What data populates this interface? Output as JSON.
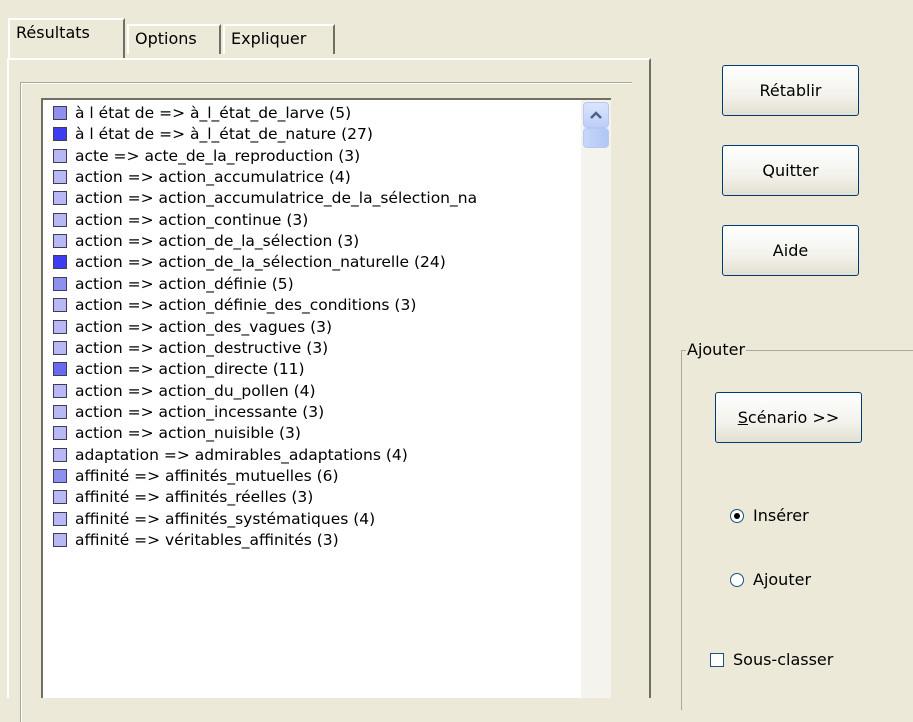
{
  "tabs": [
    {
      "label": "Résultats",
      "active": true
    },
    {
      "label": "Options",
      "active": false
    },
    {
      "label": "Expliquer",
      "active": false
    }
  ],
  "results": [
    {
      "text": "à l état de => à_l_état_de_larve (5)",
      "color": "#8f8ff0"
    },
    {
      "text": "à l état de => à_l_état_de_nature (27)",
      "color": "#3c3cf0"
    },
    {
      "text": "acte => acte_de_la_reproduction (3)",
      "color": "#b8b8f4"
    },
    {
      "text": "action => action_accumulatrice (4)",
      "color": "#b8b8f4"
    },
    {
      "text": "action => action_accumulatrice_de_la_sélection_na",
      "color": "#b8b8f4"
    },
    {
      "text": "action => action_continue (3)",
      "color": "#b8b8f4"
    },
    {
      "text": "action => action_de_la_sélection (3)",
      "color": "#b8b8f4"
    },
    {
      "text": "action => action_de_la_sélection_naturelle (24)",
      "color": "#3c3cf0"
    },
    {
      "text": "action => action_définie (5)",
      "color": "#8f8ff0"
    },
    {
      "text": "action => action_définie_des_conditions (3)",
      "color": "#b8b8f4"
    },
    {
      "text": "action => action_des_vagues (3)",
      "color": "#b8b8f4"
    },
    {
      "text": "action => action_destructive (3)",
      "color": "#b8b8f4"
    },
    {
      "text": "action => action_directe (11)",
      "color": "#6a6af0"
    },
    {
      "text": "action => action_du_pollen (4)",
      "color": "#b8b8f4"
    },
    {
      "text": "action => action_incessante (3)",
      "color": "#b8b8f4"
    },
    {
      "text": "action => action_nuisible (3)",
      "color": "#b8b8f4"
    },
    {
      "text": "adaptation => admirables_adaptations (4)",
      "color": "#b8b8f4"
    },
    {
      "text": "affinité => affinités_mutuelles (6)",
      "color": "#8f8ff0"
    },
    {
      "text": "affinité => affinités_réelles (3)",
      "color": "#b8b8f4"
    },
    {
      "text": "affinité => affinités_systématiques (4)",
      "color": "#b8b8f4"
    },
    {
      "text": "affinité => véritables_affinités (3)",
      "color": "#b8b8f4"
    }
  ],
  "buttons": {
    "retablir": "Rétablir",
    "quitter": "Quitter",
    "aide": "Aide",
    "scenario_underline": "S",
    "scenario_rest": "cénario >>"
  },
  "group": {
    "title": "Ajouter",
    "radio_insert": "Insérer",
    "radio_insert_selected": true,
    "radio_add": "Ajouter",
    "radio_add_selected": false,
    "checkbox_subclass": "Sous-classer",
    "checkbox_subclass_checked": false
  }
}
